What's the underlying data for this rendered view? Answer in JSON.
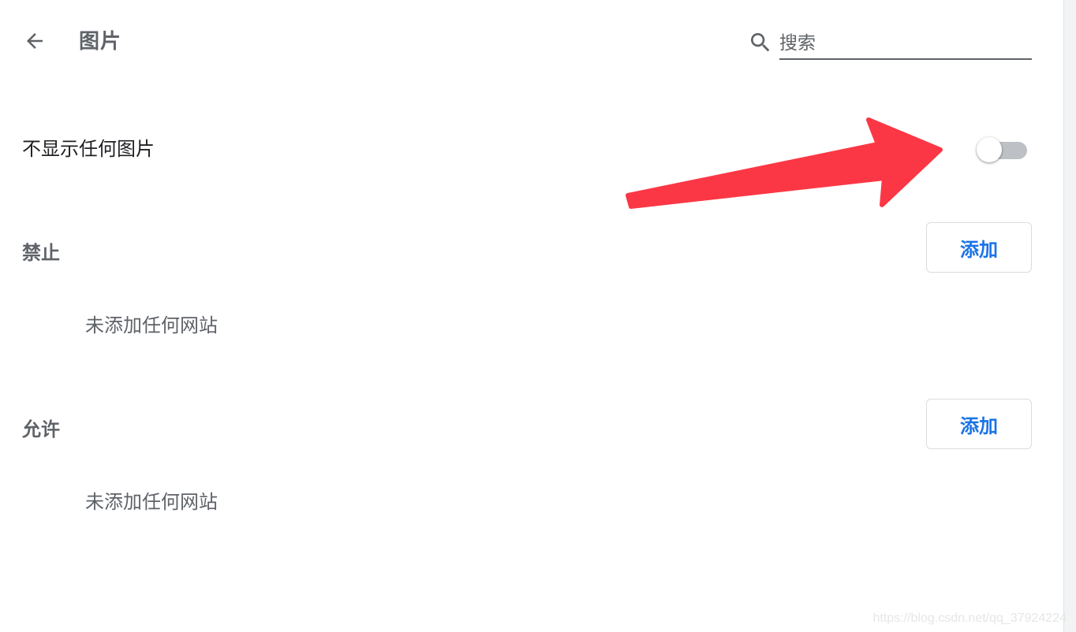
{
  "header": {
    "back_icon": "arrow-left-icon",
    "title": "图片",
    "search": {
      "icon": "search-icon",
      "placeholder": "搜索"
    }
  },
  "toggle_row": {
    "label": "不显示任何图片",
    "enabled": false
  },
  "sections": [
    {
      "title": "禁止",
      "add_label": "添加",
      "empty_text": "未添加任何网站"
    },
    {
      "title": "允许",
      "add_label": "添加",
      "empty_text": "未添加任何网站"
    }
  ],
  "annotation": {
    "arrow_color": "#fc3745"
  },
  "watermark": "https://blog.csdn.net/qq_37924224",
  "colors": {
    "accent": "#1a73e8",
    "secondary_text": "#5f6368",
    "toggle_off_track": "#bdc1c6"
  }
}
